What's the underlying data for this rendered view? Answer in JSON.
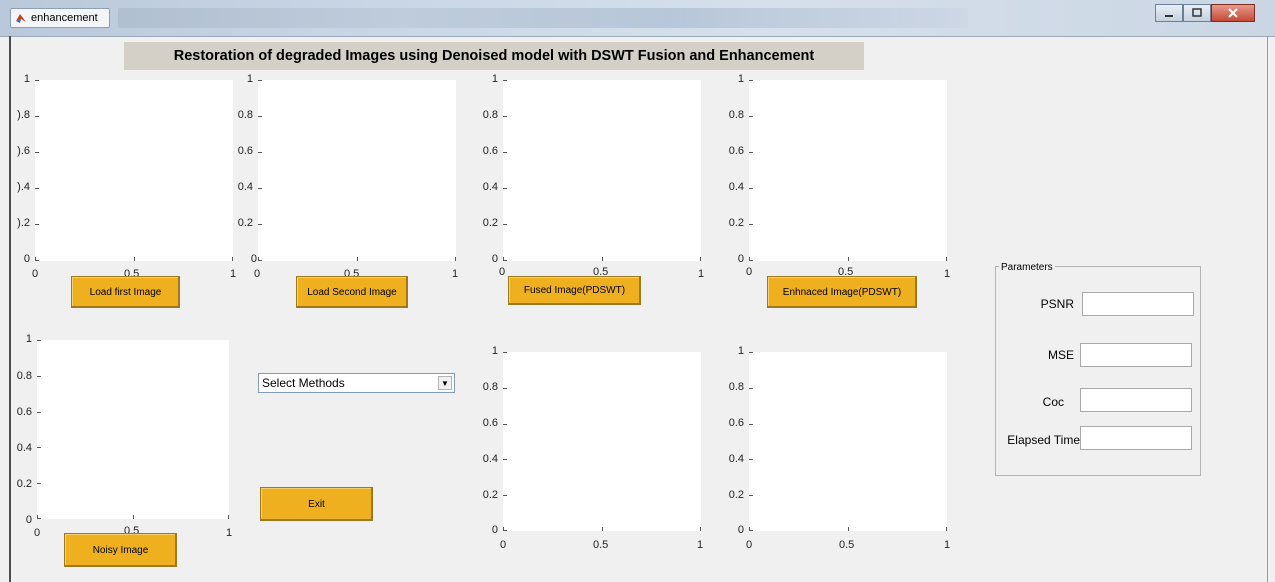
{
  "window": {
    "title": "enhancement"
  },
  "header": {
    "title": "Restoration of degraded Images using Denoised model with DSWT Fusion and Enhancement"
  },
  "axes_ticks": {
    "y": [
      "0",
      "0.2",
      "0.4",
      "0.6",
      "0.8",
      "1"
    ],
    "y_clipped": [
      "0",
      ").2",
      ").4",
      ").6",
      ").8",
      "1"
    ],
    "x": [
      "0",
      "0.5",
      "1"
    ]
  },
  "buttons": {
    "load_first": "Load first Image",
    "load_second": "Load Second Image",
    "fused": "Fused Image(PDSWT)",
    "enhanced": "Enhnaced Image(PDSWT)",
    "noisy": "Noisy Image",
    "exit": "Exit"
  },
  "methods_select": {
    "value": "Select Methods",
    "arrow": "▼"
  },
  "parameters": {
    "title": "Parameters",
    "psnr_label": "PSNR",
    "mse_label": "MSE",
    "coc_label": "Coc",
    "elapsed_label": "Elapsed Time",
    "psnr_value": "",
    "mse_value": "",
    "coc_value": "",
    "elapsed_value": ""
  }
}
